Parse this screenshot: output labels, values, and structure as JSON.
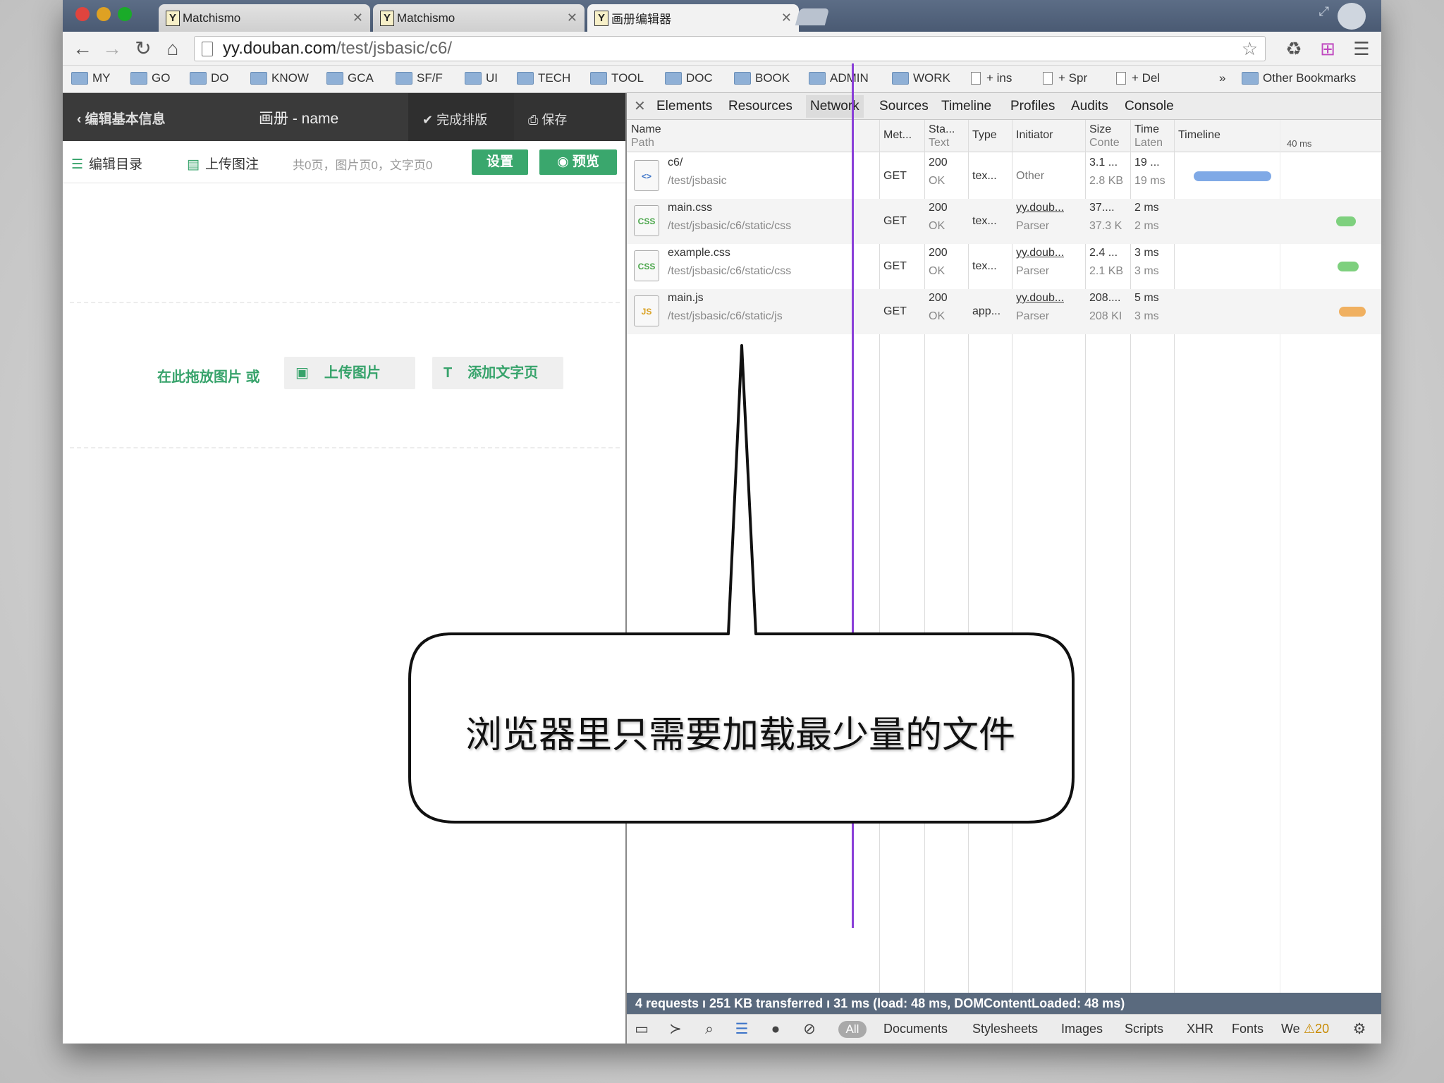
{
  "browser": {
    "tabs": [
      {
        "favicon": "Y",
        "title": "Matchismo"
      },
      {
        "favicon": "Y",
        "title": "Matchismo"
      },
      {
        "favicon": "Y",
        "title": "画册编辑器"
      }
    ],
    "url": {
      "host": "yy.douban.com",
      "path": "/test/jsbasic/c6/"
    },
    "bookmarks": [
      "MY",
      "GO",
      "DO",
      "KNOW",
      "GCA",
      "SF/F",
      "UI",
      "TECH",
      "TOOL",
      "DOC",
      "BOOK",
      "ADMIN",
      "WORK"
    ],
    "bookmark_docs": [
      "+ ins",
      "+ Spr",
      "+ Del"
    ],
    "bookmarks_more": "»",
    "other_bookmarks": "Other Bookmarks"
  },
  "app": {
    "back_label": "编辑基本信息",
    "title": "画册 - name",
    "done_label": "完成排版",
    "save_label": "保存",
    "toc_label": "编辑目录",
    "upload_caption_label": "上传图注",
    "count_text": "共0页，图片页0，文字页0",
    "settings_label": "设置",
    "preview_label": "预览",
    "drop_text": "在此拖放图片 或",
    "upload_image_label": "上传图片",
    "add_text_page_label": "添加文字页"
  },
  "devtools": {
    "tabs": [
      "Elements",
      "Resources",
      "Network",
      "Sources",
      "Timeline",
      "Profiles",
      "Audits",
      "Console"
    ],
    "selected_tab": "Network",
    "headers": {
      "name": "Name",
      "path": "Path",
      "method": "Met...",
      "status": "Sta...",
      "text": "Text",
      "type": "Type",
      "initiator": "Initiator",
      "size": "Size",
      "content": "Conte",
      "time": "Time",
      "latency": "Laten",
      "timeline": "Timeline",
      "timeline_mark": "40 ms"
    },
    "requests": [
      {
        "icon": "<>",
        "name": "c6/",
        "path": "/test/jsbasic",
        "method": "GET",
        "status": "200",
        "status_text": "OK",
        "type": "tex...",
        "initiator": "Other",
        "initiator_sub": "",
        "size": "3.1 ...",
        "content": "2.8 KB",
        "time": "19 ...",
        "latency": "19 ms",
        "bar_color": "#7fa9e6"
      },
      {
        "icon": "CSS",
        "name": "main.css",
        "path": "/test/jsbasic/c6/static/css",
        "method": "GET",
        "status": "200",
        "status_text": "OK",
        "type": "tex...",
        "initiator": "yy.doub...",
        "initiator_sub": "Parser",
        "size": "37....",
        "content": "37.3 K",
        "time": "2 ms",
        "latency": "2 ms",
        "bar_color": "#7ed07e"
      },
      {
        "icon": "CSS",
        "name": "example.css",
        "path": "/test/jsbasic/c6/static/css",
        "method": "GET",
        "status": "200",
        "status_text": "OK",
        "type": "tex...",
        "initiator": "yy.doub...",
        "initiator_sub": "Parser",
        "size": "2.4 ...",
        "content": "2.1 KB",
        "time": "3 ms",
        "latency": "3 ms",
        "bar_color": "#7ed07e"
      },
      {
        "icon": "JS",
        "name": "main.js",
        "path": "/test/jsbasic/c6/static/js",
        "method": "GET",
        "status": "200",
        "status_text": "OK",
        "type": "app...",
        "initiator": "yy.doub...",
        "initiator_sub": "Parser",
        "size": "208....",
        "content": "208 KI",
        "time": "5 ms",
        "latency": "3 ms",
        "bar_color": "#f0b060"
      }
    ],
    "status_summary": "4 requests  ı  251 KB transferred  ı  31 ms (load: 48 ms, DOMContentLoaded: 48 ms)",
    "filters": [
      "All",
      "Documents",
      "Stylesheets",
      "Images",
      "Scripts",
      "XHR",
      "Fonts",
      "We"
    ],
    "warning_count": "20"
  },
  "callout": {
    "text": "浏览器里只需要加载最少量的文件"
  }
}
